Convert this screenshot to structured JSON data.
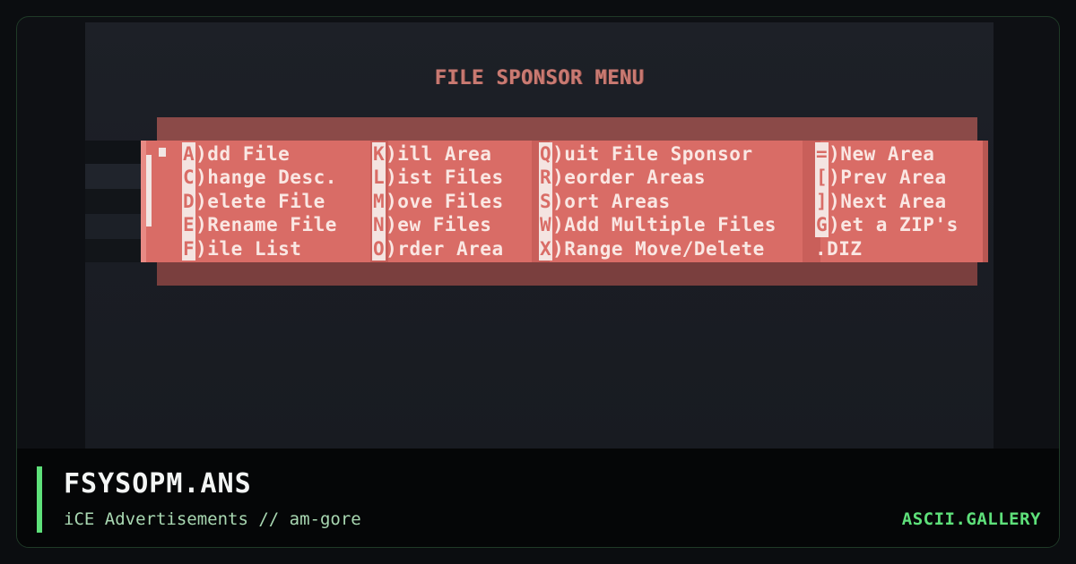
{
  "screen": {
    "menu_title": "FILE SPONSOR MENU",
    "columns": [
      [
        {
          "key": "A",
          "text": ")dd File"
        },
        {
          "key": "C",
          "text": ")hange Desc."
        },
        {
          "key": "D",
          "text": ")elete File"
        },
        {
          "key": "E",
          "text": ")Rename File"
        },
        {
          "key": "F",
          "text": ")ile List"
        }
      ],
      [
        {
          "key": "K",
          "text": ")ill Area"
        },
        {
          "key": "L",
          "text": ")ist Files"
        },
        {
          "key": "M",
          "text": ")ove Files"
        },
        {
          "key": "N",
          "text": ")ew Files"
        },
        {
          "key": "O",
          "text": ")rder Area"
        }
      ],
      [
        {
          "key": "Q",
          "text": ")uit File Sponsor"
        },
        {
          "key": "R",
          "text": ")eorder Areas"
        },
        {
          "key": "S",
          "text": ")ort Areas"
        },
        {
          "key": "W",
          "text": ")Add Multiple Files"
        },
        {
          "key": "X",
          "text": ")Range Move/Delete"
        }
      ],
      [
        {
          "key": "=",
          "text": ")New Area"
        },
        {
          "key": "[",
          "text": ")Prev Area"
        },
        {
          "key": "]",
          "text": ")Next Area"
        },
        {
          "key": "G",
          "text": ")et a ZIP's"
        },
        {
          "key": "",
          "text": " .DIZ"
        }
      ]
    ]
  },
  "caption": {
    "title": "FSYSOPM.ANS",
    "subtitle": "iCE Advertisements // am-gore",
    "brand": "ASCII.GALLERY"
  },
  "colors": {
    "accent": "#5ee07a",
    "menu_box": "#d96c66",
    "menu_title": "#c97a72"
  }
}
